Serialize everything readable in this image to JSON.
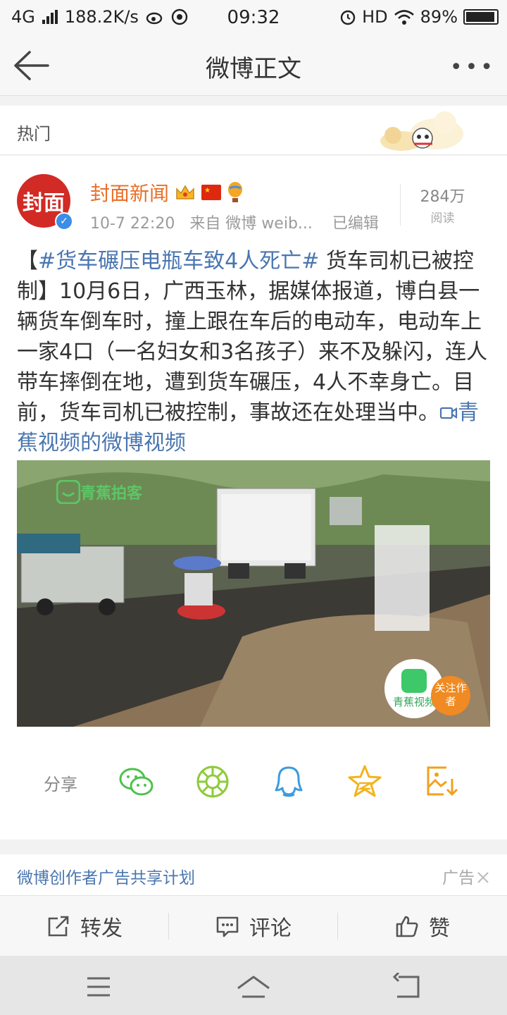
{
  "status_bar": {
    "network": "4G",
    "speed": "188.2K/s",
    "time": "09:32",
    "hd": "HD",
    "battery": "89%"
  },
  "nav": {
    "title": "微博正文"
  },
  "hot": {
    "label": "热门"
  },
  "post": {
    "author": "封面新闻",
    "avatar_text": "封面",
    "time": "10-7 22:20",
    "source": "来自 微博 weib...",
    "edited": "已编辑",
    "reads_count": "284万",
    "reads_label": "阅读",
    "content": {
      "bracket_open": "【",
      "topic": "#货车碾压电瓶车致4人死亡#",
      "body": " 货车司机已被控制】10月6日，广西玉林，据媒体报道，博白县一辆货车倒车时，撞上跟在车后的电动车，电动车上一家4口（一名妇女和3名孩子）来不及躲闪，连人带车摔倒在地，遭到货车碾压，4人不幸身亡。目前，货车司机已被控制，事故还在处理当中。",
      "video_link": "青蕉视频的微博视频"
    },
    "video": {
      "watermark": "青蕉拍客",
      "logo_text": "青蕉视频",
      "follow_label": "关注作者"
    }
  },
  "share": {
    "label": "分享",
    "targets": [
      "wechat-icon",
      "moments-icon",
      "qq-icon",
      "qzone-icon",
      "save-image-icon"
    ]
  },
  "ad": {
    "text": "微博创作者广告共享计划",
    "tag": "广告"
  },
  "actions": {
    "repost": "转发",
    "comment": "评论",
    "like": "赞"
  },
  "colors": {
    "link": "#4a76b0",
    "author": "#e8702a",
    "share_green": "#4cc24c",
    "share_blue": "#3d9be0",
    "share_gold": "#f3b31b"
  }
}
